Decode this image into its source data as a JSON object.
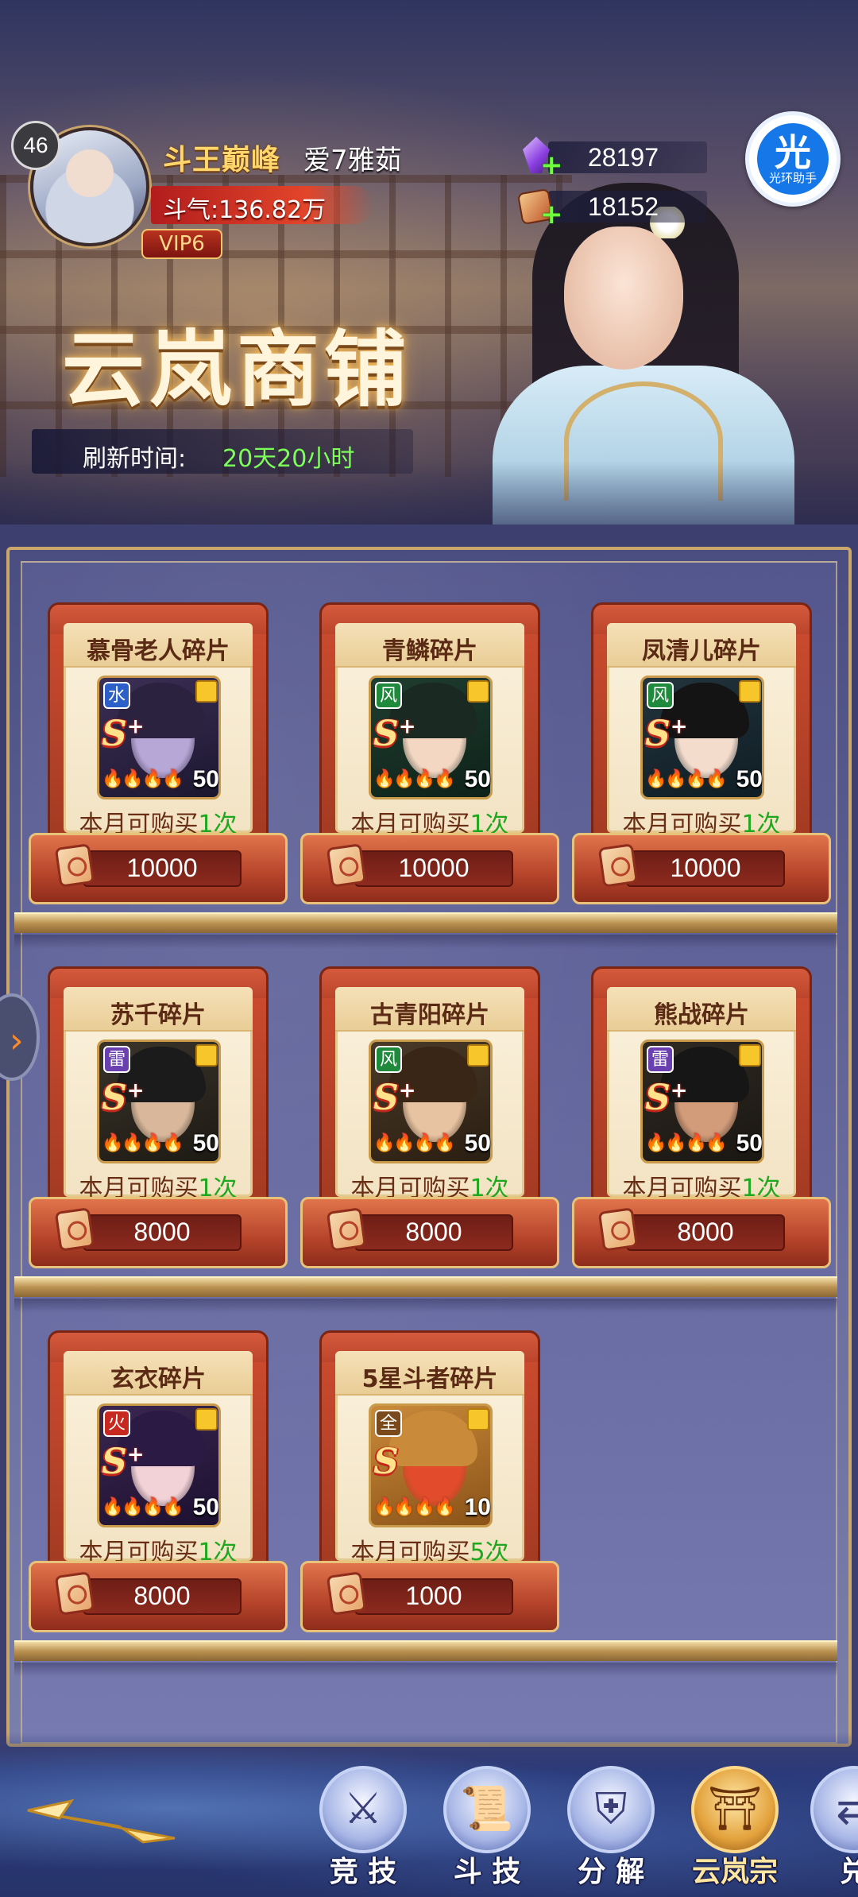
{
  "player": {
    "level": "46",
    "title": "斗王巅峰",
    "name": "爱7雅茹",
    "power": "斗气:136.82万",
    "vip": "VIP6"
  },
  "currencies": [
    {
      "icon": "crystal-icon",
      "value": "28197"
    },
    {
      "icon": "token-icon",
      "value": "18152"
    }
  ],
  "helper": {
    "glyph": "光",
    "label": "光环助手"
  },
  "shop": {
    "title": "云岚商铺",
    "refresh_label": "刷新时间:",
    "refresh_value": "20天20小时"
  },
  "items": [
    {
      "name": "慕骨老人碎片",
      "element": "水",
      "rank": "S",
      "rank_plus": "+",
      "count": "50",
      "limit_prefix": "本月可购买",
      "limit_num": "1",
      "limit_suffix": "次",
      "price": "10000"
    },
    {
      "name": "青鳞碎片",
      "element": "风",
      "rank": "S",
      "rank_plus": "+",
      "count": "50",
      "limit_prefix": "本月可购买",
      "limit_num": "1",
      "limit_suffix": "次",
      "price": "10000"
    },
    {
      "name": "凤清儿碎片",
      "element": "风",
      "rank": "S",
      "rank_plus": "+",
      "count": "50",
      "limit_prefix": "本月可购买",
      "limit_num": "1",
      "limit_suffix": "次",
      "price": "10000"
    },
    {
      "name": "苏千碎片",
      "element": "雷",
      "rank": "S",
      "rank_plus": "+",
      "count": "50",
      "limit_prefix": "本月可购买",
      "limit_num": "1",
      "limit_suffix": "次",
      "price": "8000"
    },
    {
      "name": "古青阳碎片",
      "element": "风",
      "rank": "S",
      "rank_plus": "+",
      "count": "50",
      "limit_prefix": "本月可购买",
      "limit_num": "1",
      "limit_suffix": "次",
      "price": "8000"
    },
    {
      "name": "熊战碎片",
      "element": "雷",
      "rank": "S",
      "rank_plus": "+",
      "count": "50",
      "limit_prefix": "本月可购买",
      "limit_num": "1",
      "limit_suffix": "次",
      "price": "8000"
    },
    {
      "name": "玄衣碎片",
      "element": "火",
      "rank": "S",
      "rank_plus": "+",
      "count": "50",
      "limit_prefix": "本月可购买",
      "limit_num": "1",
      "limit_suffix": "次",
      "price": "8000"
    },
    {
      "name": "5星斗者碎片",
      "element": "全",
      "rank": "S",
      "rank_plus": "",
      "count": "10",
      "limit_prefix": "本月可购买",
      "limit_num": "5",
      "limit_suffix": "次",
      "price": "1000"
    }
  ],
  "element_colors": {
    "水": "#2c5fc7",
    "风": "#1f8a3c",
    "雷": "#6a3fb0",
    "火": "#c7281f",
    "全": "#7a4a1c"
  },
  "nav": [
    {
      "label": "竞 技",
      "icon": "crossed-swords-icon"
    },
    {
      "label": "斗 技",
      "icon": "scroll-icon"
    },
    {
      "label": "分 解",
      "icon": "armor-icon"
    },
    {
      "label": "云岚宗",
      "icon": "pavilion-icon",
      "active": true
    },
    {
      "label": "兑",
      "icon": "exchange-icon"
    }
  ]
}
